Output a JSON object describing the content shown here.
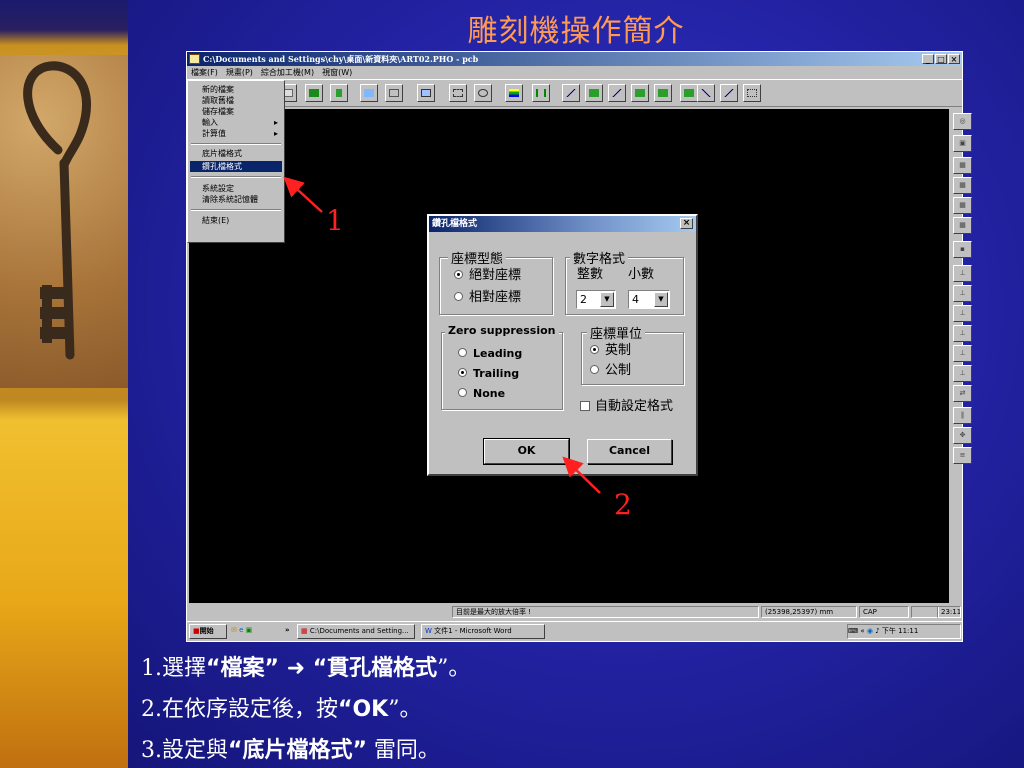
{
  "slide": {
    "title": "雕刻機操作簡介"
  },
  "window": {
    "title": "C:\\Documents and Settings\\chy\\桌面\\新資料夾\\ART02.PHO - pcb",
    "controls": [
      "_",
      "□",
      "×"
    ]
  },
  "menubar": [
    "檔案(F)",
    "規畫(P)",
    "綜合加工機(M)",
    "視窗(W)"
  ],
  "file_menu": {
    "group1": [
      "新的檔案",
      "讀取舊檔",
      "儲存檔案",
      "輸入",
      "計算值"
    ],
    "group2": [
      "底片檔格式",
      "鑽孔檔格式"
    ],
    "group3": [
      "系統設定",
      "清除系統記憶體"
    ],
    "group4": [
      "結束(E)"
    ],
    "submenu_arrow": "▸"
  },
  "dialog": {
    "title": "鑽孔檔格式",
    "close": "×",
    "coord_type": {
      "label": "座標型態",
      "options": [
        "絕對座標",
        "相對座標"
      ],
      "selected": "絕對座標"
    },
    "number_format": {
      "label": "數字格式",
      "integer_label": "整數",
      "decimal_label": "小數",
      "integer_value": "2",
      "decimal_value": "4"
    },
    "zero_suppression": {
      "label": "Zero suppression",
      "options": [
        "Leading",
        "Trailing",
        "None"
      ],
      "selected": "Trailing"
    },
    "coord_unit": {
      "label": "座標單位",
      "options": [
        "英制",
        "公制"
      ],
      "selected": "英制"
    },
    "auto_format_label": "自動設定格式",
    "auto_format_checked": false,
    "ok_label": "OK",
    "cancel_label": "Cancel"
  },
  "statusbar": {
    "message": "目前是最大的放大倍率 !",
    "coords": "(25398,25397) mm",
    "caps": "CAP",
    "time": "23:11:"
  },
  "taskbar": {
    "start": "開始",
    "chevron": "»",
    "task1": "C:\\Documents and Setting...",
    "task2": "文件1 - Microsoft Word",
    "tray_chevron": "«",
    "clock": "下午 11:11"
  },
  "annotations": {
    "label1": "1",
    "label2": "2"
  },
  "steps": {
    "s1_pre": "1.選擇",
    "s1_a": "“檔案”",
    "s1_arrow": " ➜ ",
    "s1_b": "“貫孔檔格式",
    "s1_post": "”。",
    "s2_pre": "2.在依序設定後，按",
    "s2_b": "“OK",
    "s2_post": "”。",
    "s3_pre": "3.設定與",
    "s3_b": "“底片檔格式”",
    "s3_post": " 雷同。"
  },
  "colors": {
    "title": "#ff9a55",
    "annotation": "#ff2020",
    "slide_bg": "#2424a8"
  }
}
